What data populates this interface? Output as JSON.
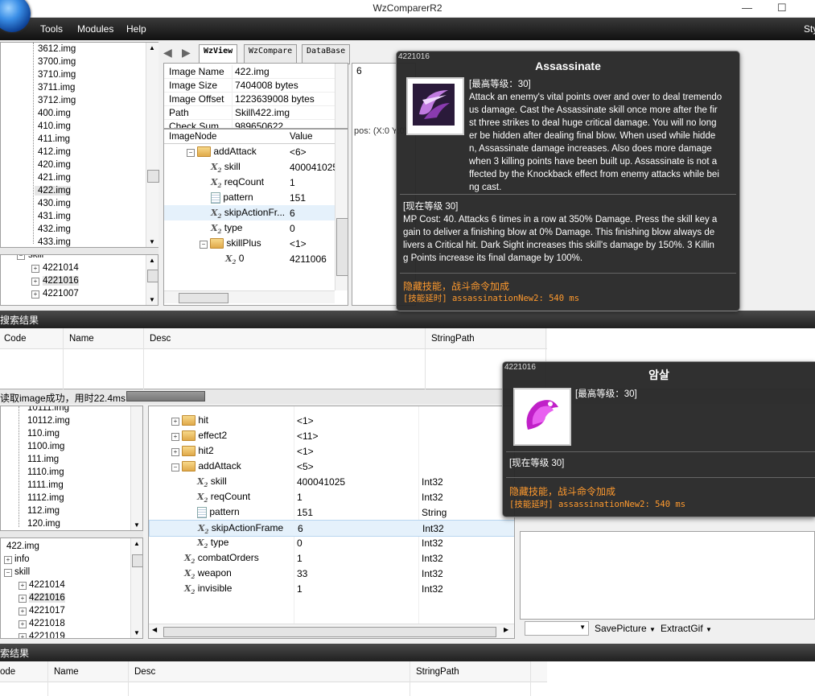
{
  "window": {
    "title": "WzComparerR2"
  },
  "menu": {
    "items": [
      "Tools",
      "Modules",
      "Help"
    ],
    "right": "Sty"
  },
  "top_tree": {
    "items": [
      "3612.img",
      "3700.img",
      "3710.img",
      "3711.img",
      "3712.img",
      "400.img",
      "410.img",
      "411.img",
      "412.img",
      "420.img",
      "421.img",
      "422.img",
      "430.img",
      "431.img",
      "432.img",
      "433.img"
    ],
    "selected": "422.img"
  },
  "top_tree2": {
    "items": [
      "skill",
      "4221014",
      "4221016",
      "4221007"
    ],
    "selected": "4221016"
  },
  "tabs": [
    "WzView",
    "WzCompare",
    "DataBase"
  ],
  "image_info": {
    "rows": [
      {
        "k": "Image Name",
        "v": "422.img"
      },
      {
        "k": "Image Size",
        "v": "7404008 bytes"
      },
      {
        "k": "Image Offset",
        "v": "1223639008 bytes"
      },
      {
        "k": "Path",
        "v": "Skill\\422.img"
      },
      {
        "k": "Check Sum",
        "v": "989650622"
      }
    ]
  },
  "node_grid_top": {
    "headers": [
      "ImageNode",
      "Value"
    ],
    "rows": [
      {
        "name": "addAttack",
        "value": "<6>",
        "type": "folder"
      },
      {
        "name": "skill",
        "value": "400041025",
        "type": "x"
      },
      {
        "name": "reqCount",
        "value": "1",
        "type": "x"
      },
      {
        "name": "pattern",
        "value": "151",
        "type": "doc"
      },
      {
        "name": "skipActionFr...",
        "value": "6",
        "type": "x"
      },
      {
        "name": "type",
        "value": "0",
        "type": "x"
      },
      {
        "name": "skillPlus",
        "value": "<1>",
        "type": "folder"
      },
      {
        "name": "0",
        "value": "4211006",
        "type": "x"
      }
    ]
  },
  "preview": {
    "value": "6",
    "pos": "pos: (X:0 Y:0)"
  },
  "search_top": {
    "title": "搜索结果",
    "headers": [
      "Code",
      "Name",
      "Desc",
      "StringPath"
    ]
  },
  "status": {
    "text": "读取image成功，用时22.4ms..."
  },
  "bottom_tree": {
    "items": [
      "10111.img",
      "10112.img",
      "110.img",
      "1100.img",
      "111.img",
      "1110.img",
      "1111.img",
      "1112.img",
      "112.img",
      "120.img"
    ]
  },
  "bottom_tree2": {
    "items": [
      "422.img",
      "info",
      "skill",
      "4221014",
      "4221016",
      "4221017",
      "4221018",
      "4221019"
    ],
    "selected": "4221016"
  },
  "node_grid_bottom": {
    "rows": [
      {
        "name": "hit",
        "value": "<1>",
        "type_col": "",
        "type": "folder"
      },
      {
        "name": "effect2",
        "value": "<11>",
        "type_col": "",
        "type": "folder"
      },
      {
        "name": "hit2",
        "value": "<1>",
        "type_col": "",
        "type": "folder"
      },
      {
        "name": "addAttack",
        "value": "<5>",
        "type_col": "",
        "type": "folder"
      },
      {
        "name": "skill",
        "value": "400041025",
        "type_col": "Int32",
        "type": "x"
      },
      {
        "name": "reqCount",
        "value": "1",
        "type_col": "Int32",
        "type": "x"
      },
      {
        "name": "pattern",
        "value": "151",
        "type_col": "String",
        "type": "doc"
      },
      {
        "name": "skipActionFrame",
        "value": "6",
        "type_col": "Int32",
        "type": "x"
      },
      {
        "name": "type",
        "value": "0",
        "type_col": "Int32",
        "type": "x"
      },
      {
        "name": "combatOrders",
        "value": "1",
        "type_col": "Int32",
        "type": "x"
      },
      {
        "name": "weapon",
        "value": "33",
        "type_col": "Int32",
        "type": "x"
      },
      {
        "name": "invisible",
        "value": "1",
        "type_col": "Int32",
        "type": "x"
      }
    ]
  },
  "toolbar_bottom": {
    "save": "SavePicture",
    "extract": "ExtractGif"
  },
  "search_bottom": {
    "title": "索结果",
    "headers": [
      "ode",
      "Name",
      "Desc",
      "StringPath"
    ]
  },
  "tooltip_en": {
    "id": "4221016",
    "title": "Assassinate",
    "max_level": "[最高等级：30]",
    "desc_lines": [
      "Attack an enemy's vital points over and over to deal tremendo",
      "us damage. Cast the Assassinate skill once more after the fir",
      "st three strikes to deal huge critical damage. You will no long",
      "er be hidden after dealing final blow. When used while hidde",
      "n, Assassinate damage increases. Also does more damage",
      "when 3 killing points have been built up. Assassinate is not a",
      "ffected by the Knockback effect from enemy attacks while bei",
      "ng cast."
    ],
    "cur_level": "[现在等级 30]",
    "cur_lines": [
      "MP Cost: 40. Attacks 6 times in a row at 350% Damage. Press the skill key a",
      "gain to deliver a finishing blow at 0% Damage. This finishing blow always de",
      "livers a Critical hit. Dark Sight increases this skill's damage by 150%. 3 Killin",
      "g Points increase its final damage by 100%."
    ],
    "hidden": "隐藏技能，战斗命令加成",
    "delay_label": "[技能延时]",
    "delay_value": "assassinationNew2: 540 ms"
  },
  "tooltip_kr": {
    "id": "4221016",
    "title": "암살",
    "max_level": "[最高等级：30]",
    "cur_level": "[现在等级 30]",
    "hidden": "隐藏技能，战斗命令加成",
    "delay_label": "[技能延时]",
    "delay_value": "assassinationNew2: 540 ms"
  },
  "colors": {
    "accent_orange": "#ff9a2e",
    "tooltip_bg": "#282828",
    "menubar": "#1a1a1a"
  }
}
